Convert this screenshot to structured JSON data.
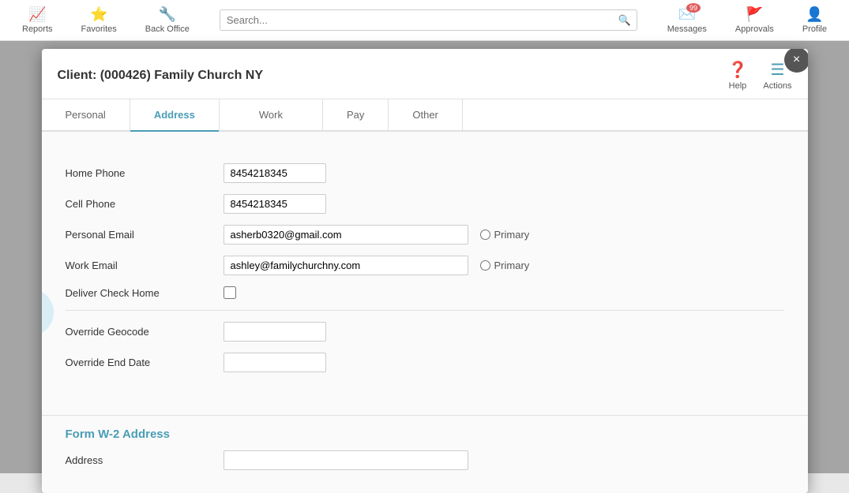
{
  "nav": {
    "items": [
      {
        "label": "Reports",
        "icon": "📈"
      },
      {
        "label": "Favorites",
        "icon": "⭐"
      },
      {
        "label": "Back Office",
        "icon": "🔧"
      },
      {
        "label": "Messages",
        "icon": "✉️",
        "badge": "99"
      },
      {
        "label": "Approvals",
        "icon": "🚩"
      },
      {
        "label": "Profile",
        "icon": "👤"
      }
    ],
    "search_placeholder": "Search..."
  },
  "modal": {
    "title": "Client: (000426) Family Church NY",
    "close_label": "×",
    "help_label": "Help",
    "actions_label": "Actions",
    "tabs": [
      {
        "label": "Personal",
        "active": false
      },
      {
        "label": "Address",
        "active": true
      },
      {
        "label": "Work",
        "active": false,
        "highlighted": true
      },
      {
        "label": "Pay",
        "active": false
      },
      {
        "label": "Other",
        "active": false
      }
    ],
    "form": {
      "home_phone_label": "Home Phone",
      "home_phone_value": "8454218345",
      "cell_phone_label": "Cell Phone",
      "cell_phone_value": "8454218345",
      "personal_email_label": "Personal Email",
      "personal_email_value": "asherb0320@gmail.com",
      "work_email_label": "Work Email",
      "work_email_value": "ashley@familychurchny.com",
      "deliver_check_home_label": "Deliver Check Home",
      "override_geocode_label": "Override Geocode",
      "override_geocode_value": "",
      "override_end_date_label": "Override End Date",
      "override_end_date_value": "",
      "primary_label": "Primary"
    },
    "w2": {
      "title": "Form W-2 Address",
      "address_label": "Address",
      "address_value": ""
    }
  }
}
